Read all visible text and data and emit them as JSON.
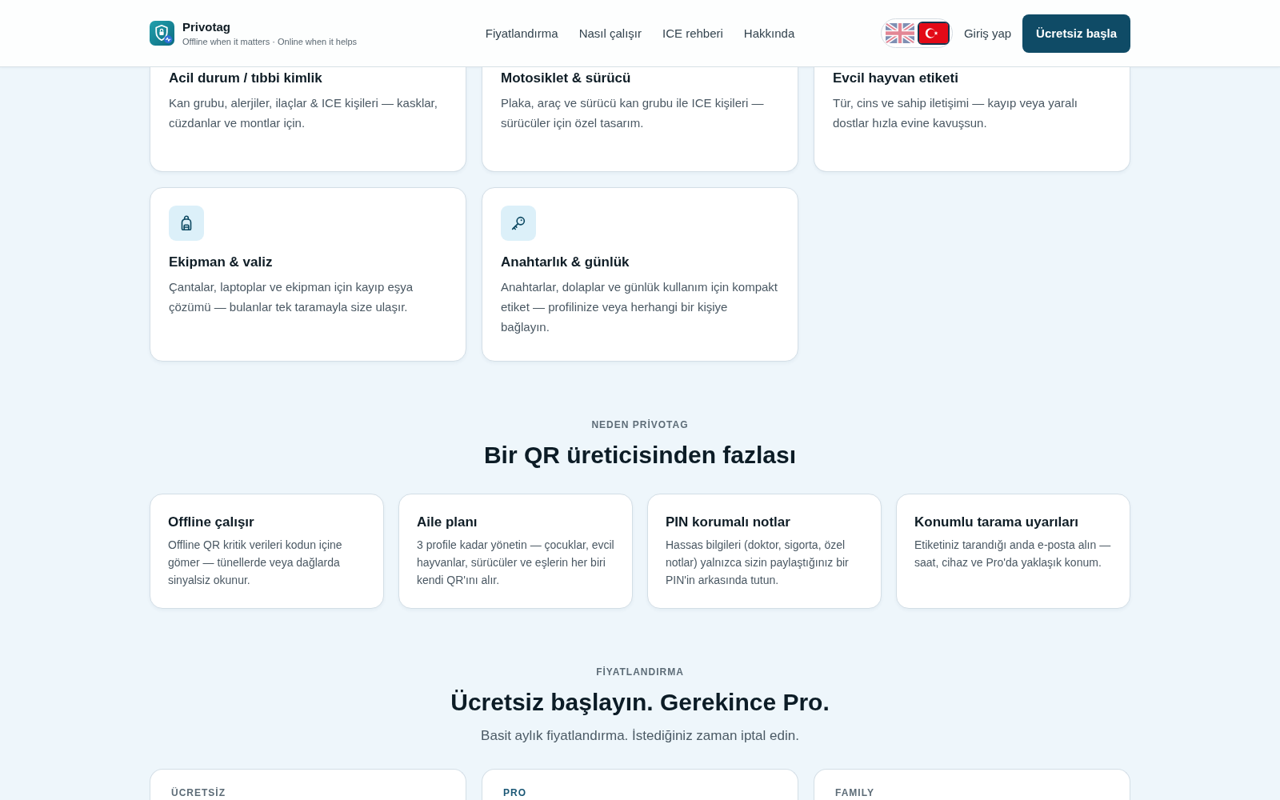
{
  "header": {
    "brand": {
      "name": "Privotag",
      "tagline": "Offline when it matters · Online when it helps"
    },
    "nav": [
      "Fiyatlandırma",
      "Nasıl çalışır",
      "ICE rehberi",
      "Hakkında"
    ],
    "languages": [
      {
        "kind": "gb",
        "selected": false
      },
      {
        "kind": "tr",
        "selected": true
      }
    ],
    "login": "Giriş yap",
    "cta": "Ücretsiz başla"
  },
  "use_cases": [
    {
      "kind": "cut_off",
      "title": "Acil durum / tıbbi kimlik",
      "description": "Kan grubu, alerjiler, ilaçlar & ICE kişileri — kasklar, cüzdanlar ve montlar için."
    },
    {
      "kind": "cut_off",
      "title": "Motosiklet & sürücü",
      "description": "Plaka, araç ve sürücü kan grubu ile ICE kişileri — sürücüler için özel tasarım."
    },
    {
      "kind": "cut_off",
      "title": "Evcil hayvan etiketi",
      "description": "Tür, cins ve sahip iletişimi — kayıp veya yaralı dostlar hızla evine kavuşsun."
    },
    {
      "kind": "bag",
      "title": "Ekipman & valiz",
      "description": "Çantalar, laptoplar ve ekipman için kayıp eşya çözümü — bulanlar tek taramayla size ulaşır."
    },
    {
      "kind": "key",
      "title": "Anahtarlık & günlük",
      "description": "Anahtarlar, dolaplar ve günlük kullanım için kompakt etiket — profilinize veya herhangi bir kişiye bağlayın."
    }
  ],
  "why": {
    "eyebrow": "NEDEN PRİVOTAG",
    "title": "Bir QR üreticisinden fazlası",
    "features": [
      {
        "title": "Offline çalışır",
        "description": "Offline QR kritik verileri kodun içine gömer — tünellerde veya dağlarda sinyalsiz okunur."
      },
      {
        "title": "Aile planı",
        "description": "3 profile kadar yönetin — çocuklar, evcil hayvanlar, sürücüler ve eşlerin her biri kendi QR'ını alır."
      },
      {
        "title": "PIN korumalı notlar",
        "description": "Hassas bilgileri (doktor, sigorta, özel notlar) yalnızca sizin paylaştığınız bir PIN'in arkasında tutun."
      },
      {
        "title": "Konumlu tarama uyarıları",
        "description": "Etiketiniz tarandığı anda e-posta alın — saat, cihaz ve Pro'da yaklaşık konum."
      }
    ]
  },
  "pricing": {
    "eyebrow": "FİYATLANDIRMA",
    "title": "Ücretsiz başlayın. Gerekince Pro.",
    "subtitle": "Basit aylık fiyatlandırma. İstediğiniz zaman iptal edin.",
    "plans": [
      {
        "name": "ÜCRETSİZ",
        "featured": false
      },
      {
        "name": "PRO",
        "featured": true
      },
      {
        "name": "FAMILY",
        "featured": false
      }
    ]
  }
}
